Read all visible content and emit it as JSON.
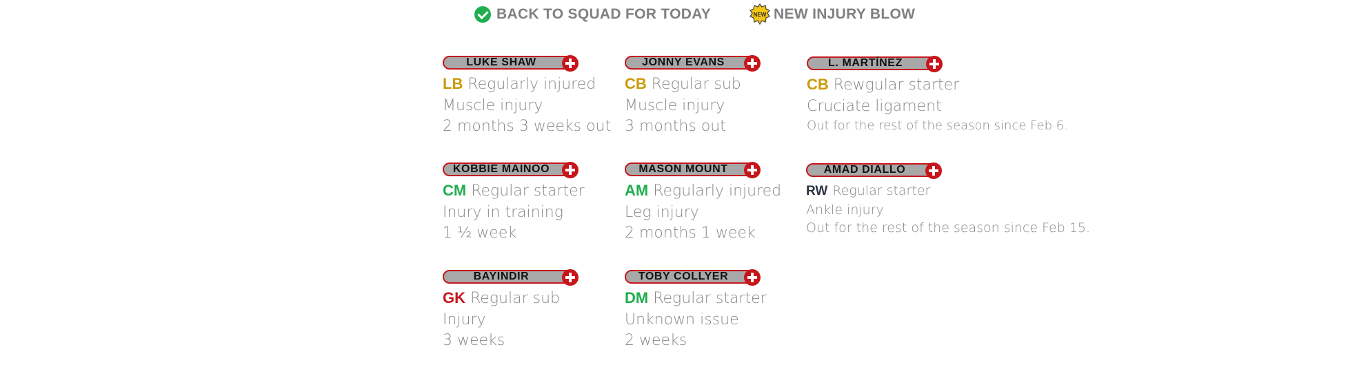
{
  "legend": [
    {
      "icon": "check-icon",
      "label": "BACK TO SQUAD FOR TODAY",
      "color": "#1fae4f"
    },
    {
      "icon": "new-badge-icon",
      "label": "NEW INJURY BLOW",
      "badge": "NEW",
      "color": "#f5c518"
    }
  ],
  "colors": {
    "pill_border": "#c6161c",
    "pill_bg": "#a8a8a8",
    "defender": "#c99a0a",
    "midfield": "#1fae4f",
    "goalkeeper": "#c6161c",
    "forward": "#2b3340",
    "text_grey": "#888888"
  },
  "players": [
    {
      "name": "LUKE SHAW",
      "pos": "LB",
      "pos_color": "#c99a0a",
      "role": "Regularly injured",
      "injury": "Muscle injury",
      "duration": "2 months 3 weeks out"
    },
    {
      "name": "JONNY EVANS",
      "pos": "CB",
      "pos_color": "#c99a0a",
      "role": "Regular sub",
      "injury": "Muscle injury",
      "duration": "3 months out"
    },
    {
      "name": "L. MARTÍNEZ",
      "pos": "CB",
      "pos_color": "#c99a0a",
      "role": "Rewgular starter",
      "injury": "Cruciate ligament",
      "duration": "Out for the rest of the season since Feb 6."
    },
    {
      "name": "KOBBIE MAINOO",
      "pos": "CM",
      "pos_color": "#1fae4f",
      "role": "Regular starter",
      "injury": "Inury in training",
      "duration": "1 ½ week"
    },
    {
      "name": "MASON MOUNT",
      "pos": "AM",
      "pos_color": "#1fae4f",
      "role": "Regularly injured",
      "injury": "Leg injury",
      "duration": "2 months 1 week"
    },
    {
      "name": "AMAD DIALLO",
      "pos": "RW",
      "pos_color": "#2b3340",
      "role": "Regular starter",
      "injury": "Ankle injury",
      "duration": "Out for the rest of the season since Feb 15."
    },
    {
      "name": "BAYINDIR",
      "pos": "GK",
      "pos_color": "#c6161c",
      "role": "Regular sub",
      "injury": "Injury",
      "duration": "3 weeks"
    },
    {
      "name": "TOBY COLLYER",
      "pos": "DM",
      "pos_color": "#1fae4f",
      "role": "Regular starter",
      "injury": "Unknown issue",
      "duration": "2 weeks"
    }
  ]
}
